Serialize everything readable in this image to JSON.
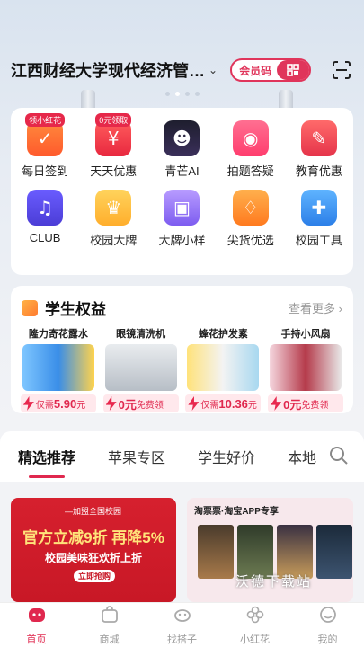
{
  "header": {
    "campus_name": "江西财经大学现代经济管…",
    "member_code_label": "会员码"
  },
  "grid": [
    {
      "label": "每日签到",
      "icon": "daily-checkin-icon",
      "tag": "领小红花"
    },
    {
      "label": "天天优惠",
      "icon": "discount-icon",
      "tag": "0元领取"
    },
    {
      "label": "青芒AI",
      "icon": "ai-mascot-icon",
      "tag": ""
    },
    {
      "label": "拍题答疑",
      "icon": "camera-icon",
      "tag": ""
    },
    {
      "label": "教育优惠",
      "icon": "education-icon",
      "tag": ""
    },
    {
      "label": "CLUB",
      "icon": "club-icon",
      "tag": ""
    },
    {
      "label": "校园大牌",
      "icon": "crown-icon",
      "tag": ""
    },
    {
      "label": "大牌小样",
      "icon": "sample-icon",
      "tag": ""
    },
    {
      "label": "尖货优选",
      "icon": "shopping-bag-icon",
      "tag": ""
    },
    {
      "label": "校园工具",
      "icon": "puzzle-icon",
      "tag": ""
    }
  ],
  "rights": {
    "title": "学生权益",
    "more": "查看更多 ›",
    "products": [
      {
        "name": "隆力奇花露水",
        "prefix": "仅需",
        "price": "5.90",
        "suffix": "元"
      },
      {
        "name": "眼镜清洗机",
        "prefix": "",
        "price": "0元",
        "suffix": "免费领"
      },
      {
        "name": "蜂花护发素",
        "prefix": "仅需",
        "price": "10.36",
        "suffix": "元"
      },
      {
        "name": "手持小风扇",
        "prefix": "",
        "price": "0元",
        "suffix": "免费领"
      }
    ]
  },
  "tabs": [
    "精选推荐",
    "苹果专区",
    "学生好价",
    "本地"
  ],
  "banners": {
    "left": {
      "logo": "—加盟全国校园",
      "line1": "官方立减9折 再降5%",
      "line2": "校园美味狂欢折上折",
      "button": "立即抢购"
    },
    "right": {
      "header": "淘票票·淘宝APP专享"
    }
  },
  "watermark": "沃德下载站",
  "nav": [
    {
      "label": "首页",
      "icon": "home-icon",
      "active": true
    },
    {
      "label": "商城",
      "icon": "mall-icon",
      "active": false
    },
    {
      "label": "找搭子",
      "icon": "buddy-icon",
      "active": false
    },
    {
      "label": "小红花",
      "icon": "flower-icon",
      "active": false
    },
    {
      "label": "我的",
      "icon": "profile-icon",
      "active": false
    }
  ],
  "colors": {
    "accent": "#e0284e",
    "background": "#f2f3f6"
  }
}
